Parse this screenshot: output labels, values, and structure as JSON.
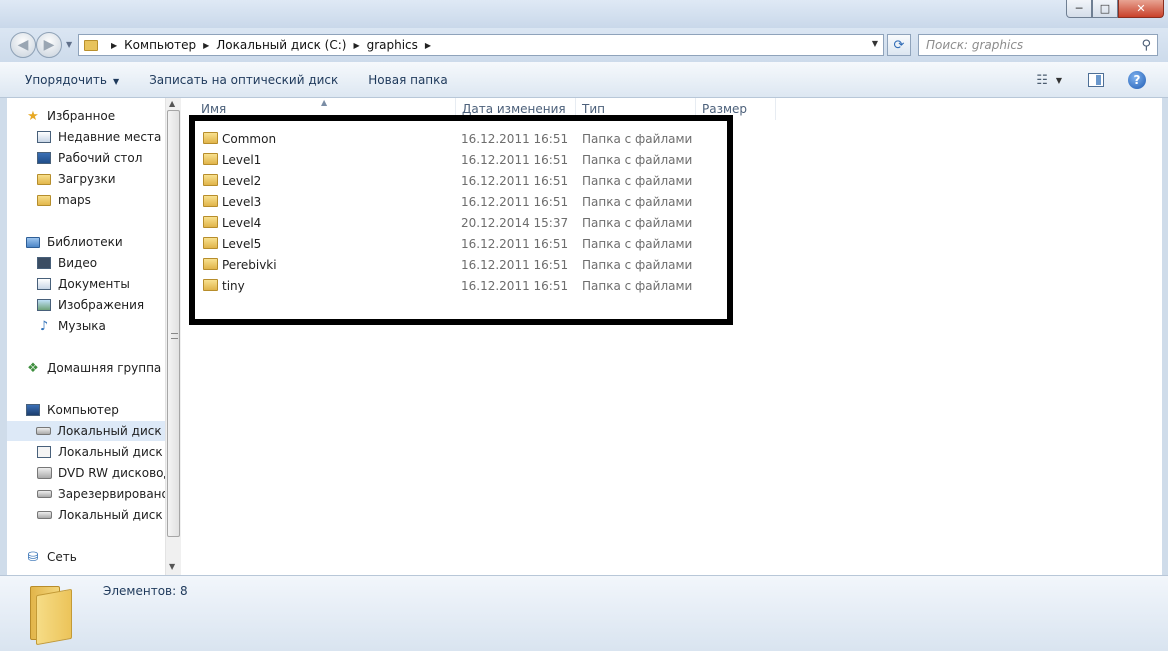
{
  "window": {
    "controls": {
      "minimize": "─",
      "maximize": "□",
      "close": "✕"
    }
  },
  "address": {
    "back_icon": "back-arrow-icon",
    "forward_icon": "forward-arrow-icon",
    "crumbs": [
      "Компьютер",
      "Локальный диск (C:)",
      "graphics"
    ],
    "refresh_icon": "refresh-icon"
  },
  "search": {
    "placeholder": "Поиск: graphics"
  },
  "toolbar": {
    "organize": "Упорядочить",
    "burn": "Записать на оптический диск",
    "new_folder": "Новая папка"
  },
  "nav": {
    "favorites": {
      "title": "Избранное",
      "items": [
        "Недавние места",
        "Рабочий стол",
        "Загрузки",
        "maps"
      ]
    },
    "libraries": {
      "title": "Библиотеки",
      "items": [
        "Видео",
        "Документы",
        "Изображения",
        "Музыка"
      ]
    },
    "homegroup": "Домашняя группа",
    "computer": {
      "title": "Компьютер",
      "items": [
        "Локальный диск (C",
        "Локальный диск (D",
        "DVD RW дисковод (",
        "Зарезервировано с",
        "Локальный диск (Q"
      ],
      "selected_index": 0
    },
    "network": "Сеть"
  },
  "columns": {
    "name": "Имя",
    "date": "Дата изменения",
    "type": "Тип",
    "size": "Размер"
  },
  "files": [
    {
      "name": "Common",
      "date": "16.12.2011 16:51",
      "type": "Папка с файлами"
    },
    {
      "name": "Level1",
      "date": "16.12.2011 16:51",
      "type": "Папка с файлами"
    },
    {
      "name": "Level2",
      "date": "16.12.2011 16:51",
      "type": "Папка с файлами"
    },
    {
      "name": "Level3",
      "date": "16.12.2011 16:51",
      "type": "Папка с файлами"
    },
    {
      "name": "Level4",
      "date": "20.12.2014 15:37",
      "type": "Папка с файлами"
    },
    {
      "name": "Level5",
      "date": "16.12.2011 16:51",
      "type": "Папка с файлами"
    },
    {
      "name": "Perebivki",
      "date": "16.12.2011 16:51",
      "type": "Папка с файлами"
    },
    {
      "name": "tiny",
      "date": "16.12.2011 16:51",
      "type": "Папка с файлами"
    }
  ],
  "status": {
    "items_count": "Элементов: 8"
  },
  "colors": {
    "accent": "#1e395b",
    "frame": "#cfdcea",
    "selection": "#dde9f7",
    "annotation_box": "#000000"
  }
}
